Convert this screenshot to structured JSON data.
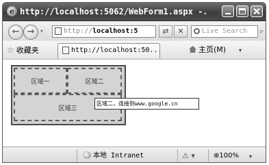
{
  "window": {
    "title": "http://localhost:5062/WebForm1.aspx -...",
    "app_icon": "e",
    "controls": {
      "minimize": "minimize-icon",
      "maximize": "maximize-icon",
      "close": "close-icon"
    }
  },
  "nav": {
    "back_glyph": "←",
    "forward_glyph": "→",
    "dropdown_glyph": "▾",
    "address_dim": "http://",
    "address_host": "localhost:5",
    "refresh_glyph": "⇄",
    "stop_glyph": "✕",
    "search_placeholder": "Live Search",
    "search_go_glyph": "⌕"
  },
  "favorites": {
    "star_glyph": "☆",
    "label": "收藏夹",
    "tab_label": "http://localhost:50...",
    "home_label": "主页(M)",
    "home_dropdown": "▾"
  },
  "content": {
    "areas": [
      {
        "label": "区域一"
      },
      {
        "label": "区域二"
      },
      {
        "label": "区域三"
      }
    ],
    "tooltip_prefix": "区域二，连接到",
    "tooltip_url": "www.google.cn"
  },
  "statusbar": {
    "zone_label": "本地 Intranet",
    "protect_glyph": "⚠ ▾",
    "zoom_label": "⊕100%",
    "zoom_dropdown": "▾"
  }
}
